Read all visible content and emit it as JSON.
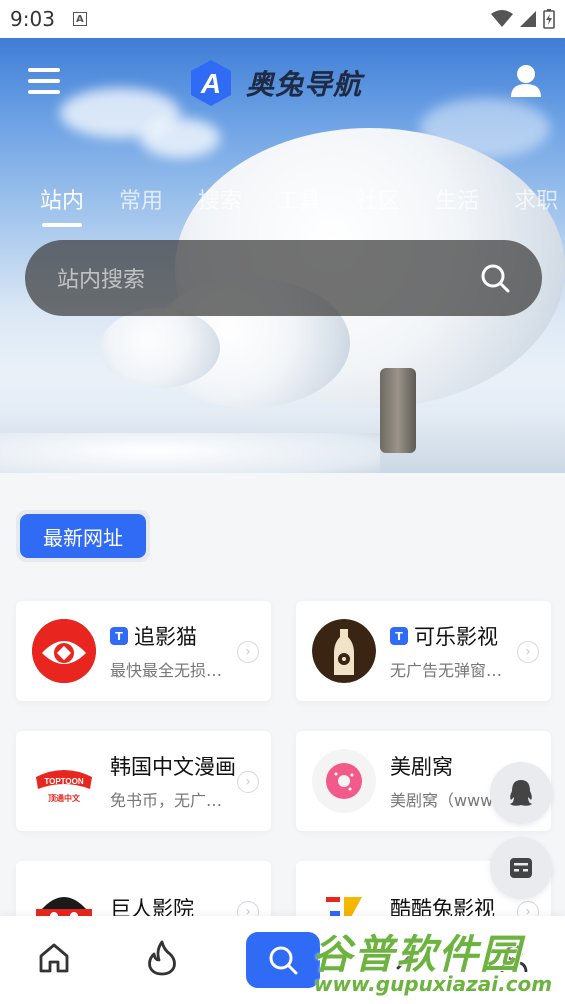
{
  "status_bar": {
    "time": "9:03",
    "notification_badge": "A",
    "icons": [
      "wifi-icon",
      "signal-icon",
      "battery-icon"
    ]
  },
  "header": {
    "app_name": "奥兔导航",
    "logo_letter": "A"
  },
  "tabs": [
    {
      "label": "站内",
      "active": true
    },
    {
      "label": "常用",
      "active": false
    },
    {
      "label": "搜索",
      "active": false
    },
    {
      "label": "工具",
      "active": false
    },
    {
      "label": "社区",
      "active": false
    },
    {
      "label": "生活",
      "active": false
    },
    {
      "label": "求职",
      "active": false
    }
  ],
  "search": {
    "placeholder": "站内搜索"
  },
  "section": {
    "label": "最新网址"
  },
  "cards": [
    {
      "title": "追影猫",
      "desc": "最快最全无损…",
      "tag": "T"
    },
    {
      "title": "可乐影视",
      "desc": "无广告无弹窗…",
      "tag": "T"
    },
    {
      "title": "韩国中文漫画",
      "desc": "免书币，无广…",
      "tag": "",
      "icon_text_top": "TOPTOON",
      "icon_text_bottom": "顶通中文"
    },
    {
      "title": "美剧窝",
      "desc": "美剧窝（www.",
      "tag": ""
    },
    {
      "title": "巨人影院",
      "desc": "",
      "tag": ""
    },
    {
      "title": "酷酷兔影视",
      "desc": "",
      "tag": ""
    }
  ],
  "bottom_nav": [
    "home-icon",
    "fire-icon",
    "search-icon",
    "tool-icon",
    "user-icon"
  ],
  "watermark": {
    "cn": "谷普软件园",
    "url": "www.gupuxiazai.com"
  },
  "colors": {
    "accent": "#2f6bf5",
    "watermark": "#6db33f"
  }
}
